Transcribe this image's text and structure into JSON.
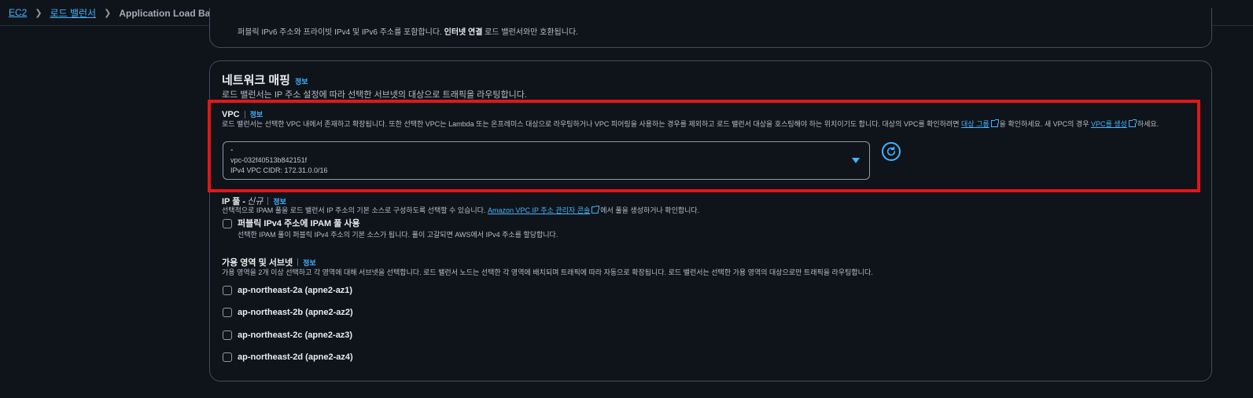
{
  "breadcrumb": {
    "items": [
      "EC2",
      "로드 밸런서"
    ],
    "current": "Application Load Balancer 생성"
  },
  "top_section": {
    "text_before": "퍼블릭 IPv6 주소와 프라이빗 IPv4 및 IPv6 주소를 포함합니다. ",
    "bold": "인터넷 연결",
    "text_after": " 로드 밸런서와만 호환됩니다."
  },
  "network_mapping": {
    "title": "네트워크 매핑",
    "info": "정보",
    "description": "로드 밸런서는 IP 주소 설정에 따라 선택한 서브넷의 대상으로 트래픽을 라우팅합니다."
  },
  "vpc": {
    "label": "VPC",
    "info": "정보",
    "desc_part1": "로드 밸런서는 선택한 VPC 내에서 존재하고 확장됩니다. 또한 선택한 VPC는 Lambda 또는 온프레미스 대상으로 라우팅하거나 VPC 피어링을 사용하는 경우를 제외하고 로드 밸런서 대상을 호스팅해야 하는 위치이기도 합니다. 대상의 VPC를 확인하려면 ",
    "desc_link1": "대상 그룹",
    "desc_part2": "을 확인하세요. 새 VPC의 경우 ",
    "desc_link2": "VPC를 생성",
    "desc_part3": "하세요.",
    "selected_name": "-",
    "selected_id": "vpc-032f40513b842151f",
    "selected_cidr": "IPv4 VPC CIDR: 172.31.0.0/16"
  },
  "ip_pool": {
    "label": "IP 풀 - ",
    "new_tag": "신규",
    "info": "정보",
    "desc_part1": "선택적으로 IPAM 풀을 로드 밸런서 IP 주소의 기본 소스로 구성하도록 선택할 수 있습니다. ",
    "desc_link": "Amazon VPC IP 주소 관리자 콘솔",
    "desc_part2": "에서 풀을 생성하거나 확인합니다.",
    "checkbox_label": "퍼블릭 IPv4 주소에 IPAM 풀 사용",
    "checkbox_desc": "선택한 IPAM 풀이 퍼블릭 IPv4 주소의 기본 소스가 됩니다. 풀이 고갈되면 AWS에서 IPv4 주소를 할당합니다."
  },
  "availability_zones": {
    "label": "가용 영역 및 서브넷",
    "info": "정보",
    "description": "가용 영역을 2개 이상 선택하고 각 영역에 대해 서브넷을 선택합니다. 로드 밸런서 노드는 선택한 각 영역에 배치되며 트래픽에 따라 자동으로 확장됩니다. 로드 밸런서는 선택한 가용 영역의 대상으로만 트래픽을 라우팅합니다.",
    "zones": [
      "ap-northeast-2a (apne2-az1)",
      "ap-northeast-2b (apne2-az2)",
      "ap-northeast-2c (apne2-az3)",
      "ap-northeast-2d (apne2-az4)"
    ]
  },
  "colors": {
    "background": "#0f141a",
    "link": "#42b4ff",
    "border": "#414d5c",
    "highlight": "#e0171b"
  }
}
